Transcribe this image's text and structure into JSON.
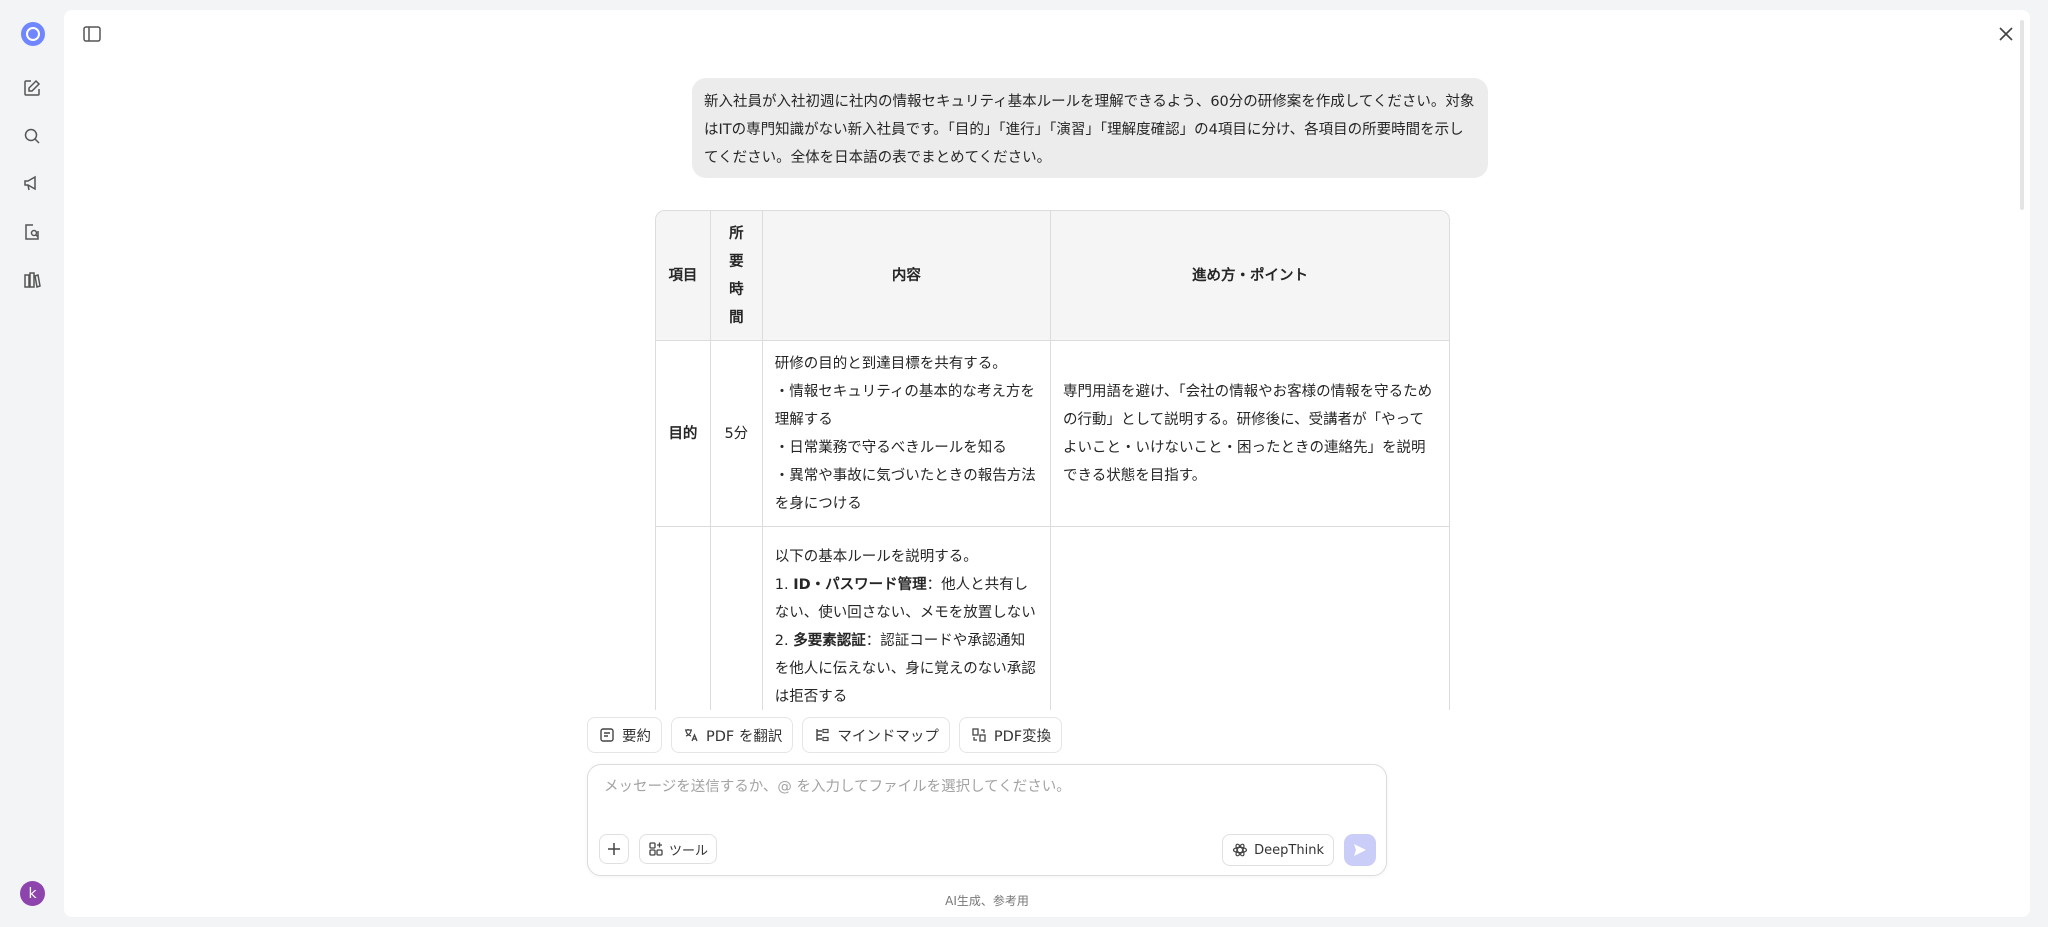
{
  "user_message": "新入社員が入社初週に社内の情報セキュリティ基本ルールを理解できるよう、60分の研修案を作成してください。対象はITの専門知識がない新入社員です。「目的」「進行」「演習」「理解度確認」の4項目に分け、各項目の所要時間を示してください。全体を日本語の表でまとめてください。",
  "table": {
    "headers": [
      "項目",
      "所要時間",
      "内容",
      "進め方・ポイント"
    ],
    "row1": {
      "item": "目的",
      "time": "5分",
      "content": [
        "研修の目的と到達目標を共有する。",
        "・情報セキュリティの基本的な考え方を理解する",
        "・日常業務で守るべきルールを知る",
        "・異常や事故に気づいたときの報告方法を身につける"
      ],
      "points": "専門用語を避け、「会社の情報やお客様の情報を守るための行動」として説明する。研修後に、受講者が「やってよいこと・いけないこと・困ったときの連絡先」を説明できる状態を目指す。"
    },
    "row2": {
      "intro": "以下の基本ルールを説明する。",
      "rule1_prefix": "1. ",
      "rule1_title": "ID・パスワード管理",
      "rule1_text": "：他人と共有しない、使い回さない、メモを放置しない",
      "rule2_prefix": "2. ",
      "rule2_title": "多要素認証",
      "rule2_text": "：認証コードや承認通知を他人に伝えない、身に覚えのない承認は拒否する"
    }
  },
  "actions": [
    "要約",
    "PDF を翻訳",
    "マインドマップ",
    "PDF変換"
  ],
  "composer": {
    "placeholder": "メッセージを送信するか、@ を入力してファイルを選択してください。",
    "tools_label": "ツール",
    "deepthink_label": "DeepThink"
  },
  "footer_note": "AI生成、参考用",
  "avatar_letter": "k",
  "colors": {
    "accent": "#6f86ff",
    "avatar": "#8e44ad",
    "send_disabled": "#c9cdf8"
  }
}
